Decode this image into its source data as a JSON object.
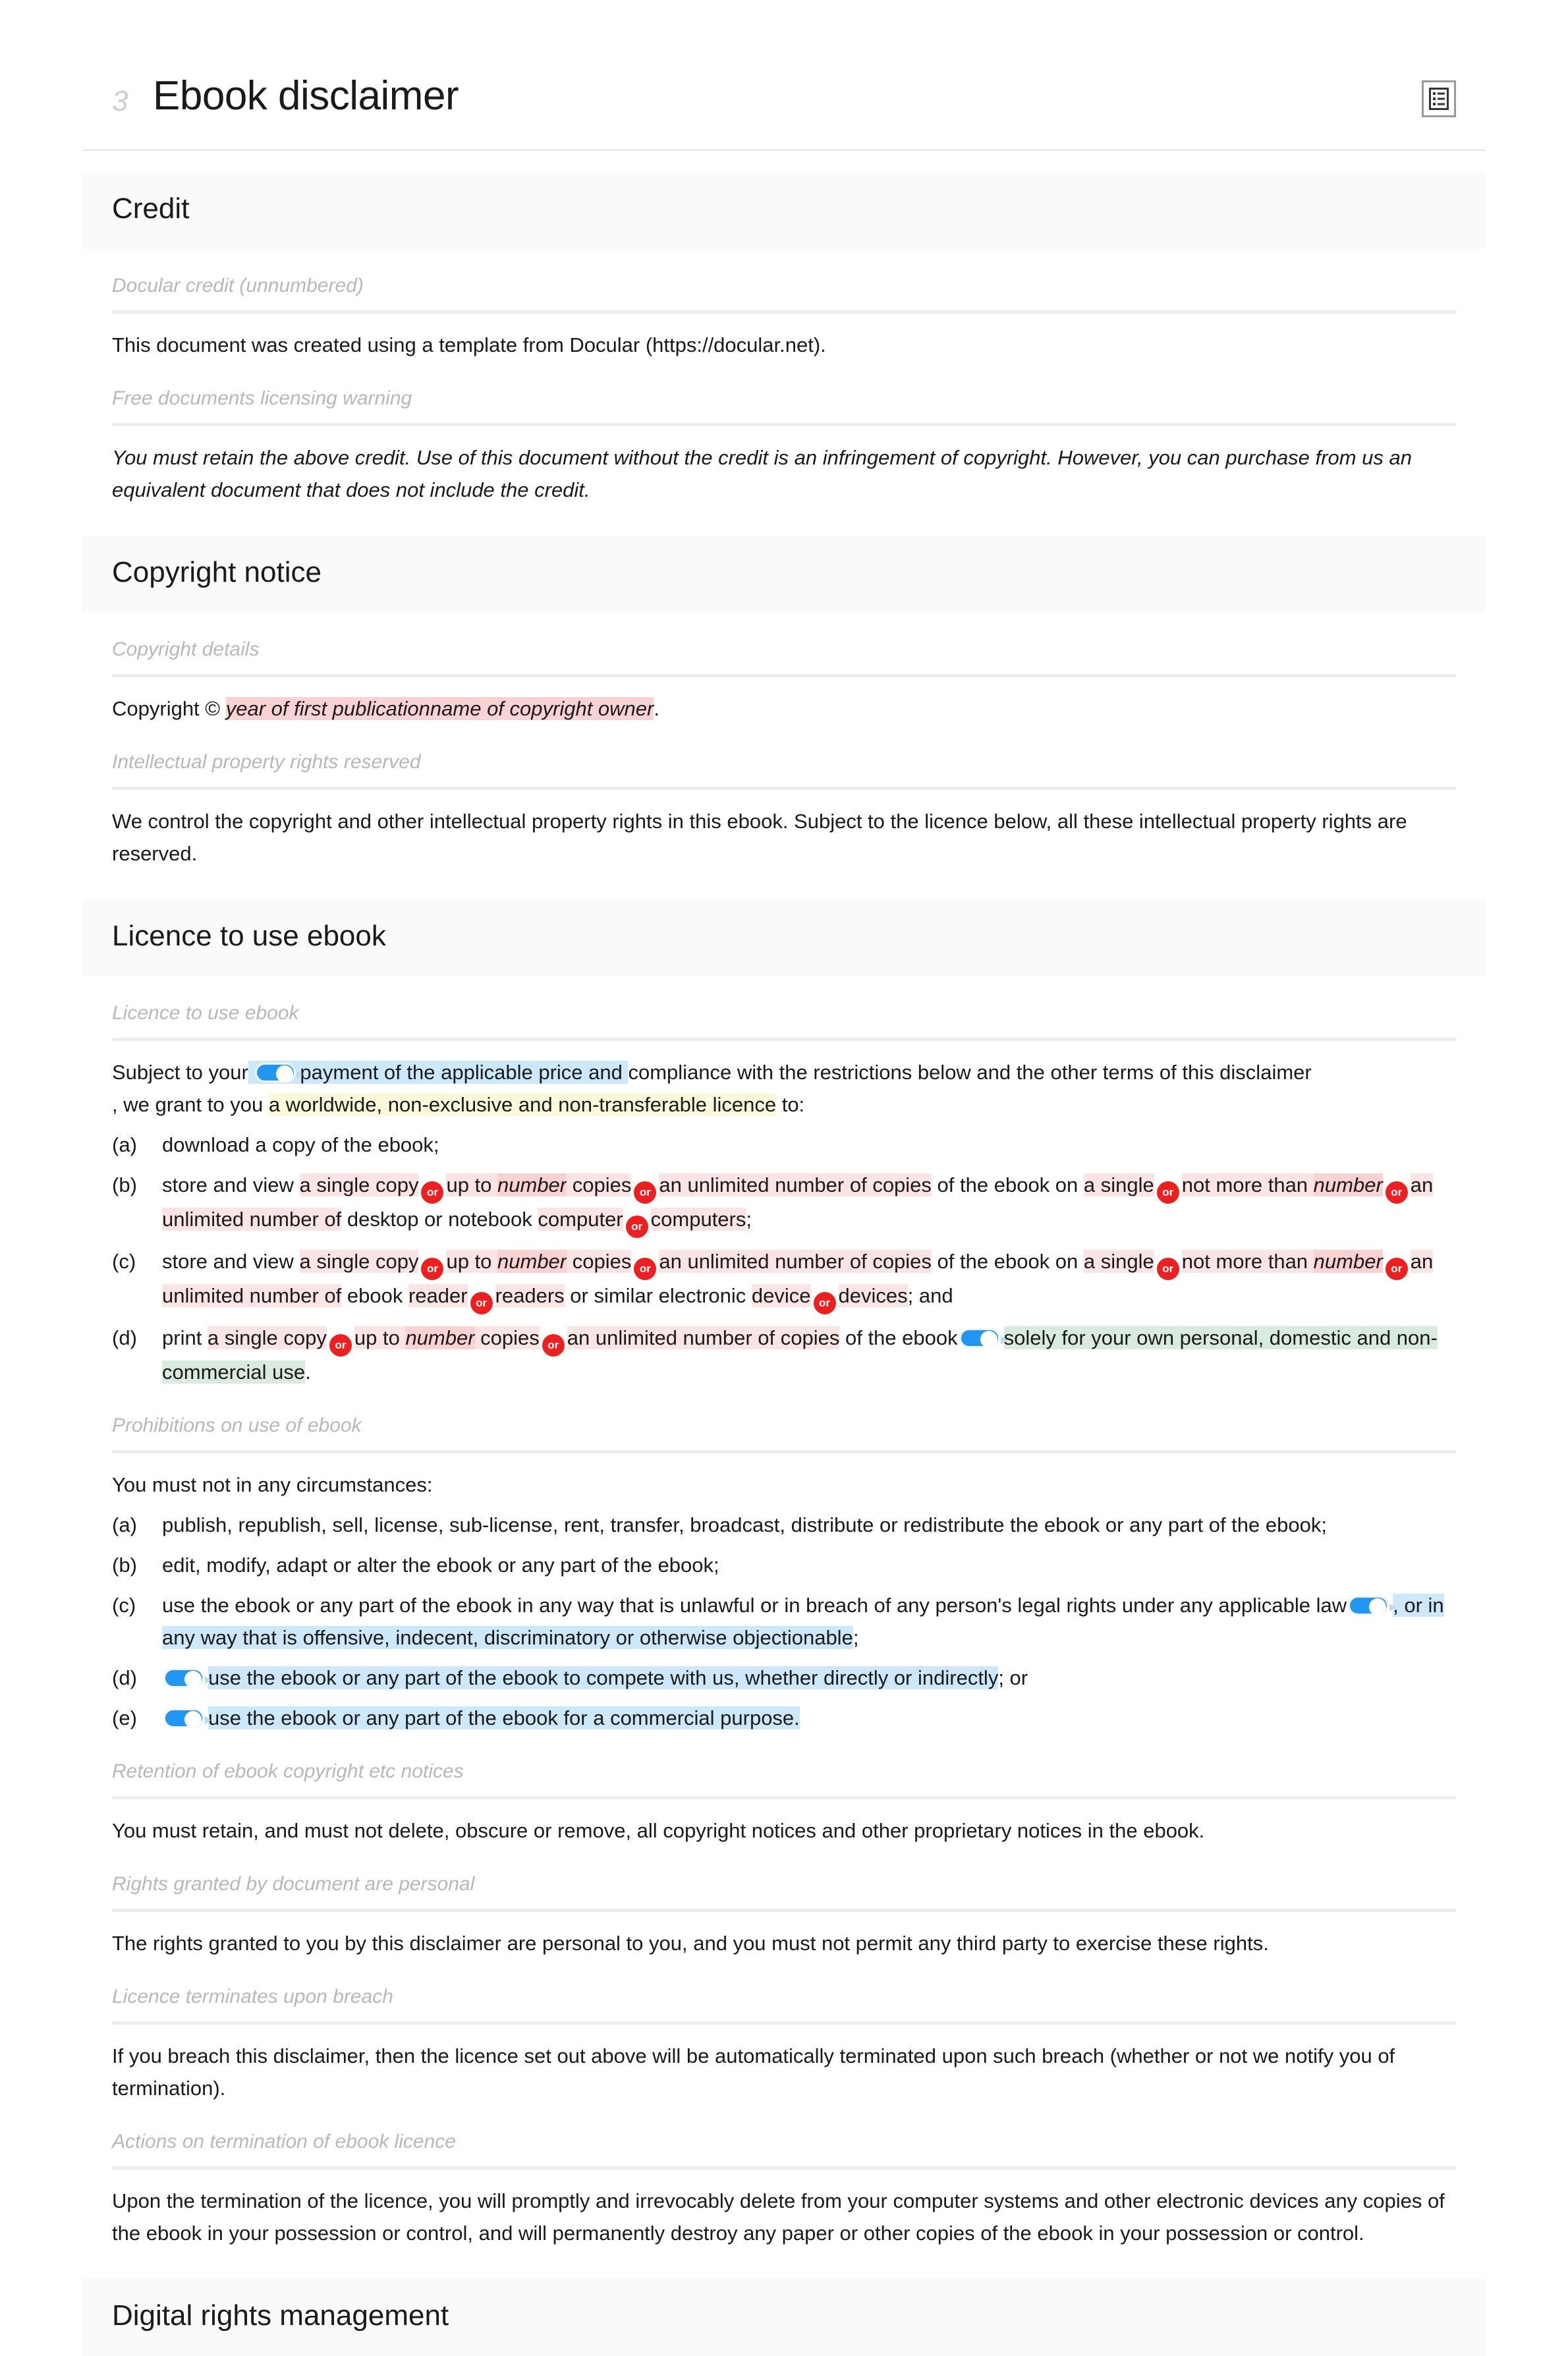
{
  "header": {
    "page_number": "3",
    "title": "Ebook disclaimer",
    "toc_icon": "list-document-icon"
  },
  "colors": {
    "accent_blue": "#2196f3",
    "badge_red": "#ef1f1f",
    "highlight_pink": "#fbe4e4",
    "highlight_pink_deep": "#fad2d2",
    "highlight_blue": "#cde8fb",
    "highlight_yellow": "#fbf8dc",
    "highlight_green": "#d9ebdf",
    "band_gray": "#fafafa",
    "label_gray": "#b8b8b8"
  },
  "sections": [
    {
      "title": "Credit",
      "clauses": [
        {
          "label": "Docular credit (unnumbered)",
          "text": "This document was created using a template from Docular (https://docular.net)."
        },
        {
          "label": "Free documents licensing warning",
          "text": "You must retain the above credit. Use of this document without the credit is an infringement of copyright. However, you can purchase from us an equivalent document that does not include the credit."
        }
      ]
    },
    {
      "title": "Copyright notice",
      "clauses": [
        {
          "label": "Copyright details",
          "text_prefix": "Copyright © ",
          "var_year": "year of first publication",
          "var_owner": "name of copyright owner",
          "text_suffix": "."
        },
        {
          "label": "Intellectual property rights reserved",
          "text": "We control the copyright and other intellectual property rights in this ebook. Subject to the licence below, all these intellectual property rights are reserved."
        }
      ]
    },
    {
      "title": "Licence to use ebook",
      "clauses": [
        {
          "label": "Licence to use ebook",
          "intro": {
            "p1": "Subject to your",
            "opt_payment": "payment of the applicable price and",
            "p2": "compliance with the restrictions below and the other terms of this disclaimer",
            "p3": ", we grant to you",
            "opt_licence": "a worldwide, non-exclusive and non-transferable licence",
            "p4": "to:"
          },
          "items": [
            {
              "marker": "(a)",
              "parts": [
                {
                  "t": "plain",
                  "v": "download a copy of the ebook;"
                }
              ]
            },
            {
              "marker": "(b)",
              "parts": [
                {
                  "t": "plain",
                  "v": "store and view "
                },
                {
                  "t": "pink",
                  "v": "a single copy"
                },
                {
                  "t": "or",
                  "v": "or"
                },
                {
                  "t": "pink",
                  "v": "up to "
                },
                {
                  "t": "pinkd",
                  "v": "number"
                },
                {
                  "t": "pink",
                  "v": " copies"
                },
                {
                  "t": "or",
                  "v": "or"
                },
                {
                  "t": "pink",
                  "v": "an unlimited number of copies"
                },
                {
                  "t": "plain",
                  "v": " of the ebook on "
                },
                {
                  "t": "pink",
                  "v": "a single"
                },
                {
                  "t": "or",
                  "v": "or"
                },
                {
                  "t": "pink",
                  "v": "not more than "
                },
                {
                  "t": "pinkd",
                  "v": "number"
                },
                {
                  "t": "or",
                  "v": "or"
                },
                {
                  "t": "pink",
                  "v": "an unlimited number of"
                },
                {
                  "t": "plain",
                  "v": " desktop or notebook "
                },
                {
                  "t": "pink",
                  "v": "computer"
                },
                {
                  "t": "or",
                  "v": "or"
                },
                {
                  "t": "pink",
                  "v": "computers"
                },
                {
                  "t": "plain",
                  "v": ";"
                }
              ]
            },
            {
              "marker": "(c)",
              "parts": [
                {
                  "t": "plain",
                  "v": "store and view "
                },
                {
                  "t": "pink",
                  "v": "a single copy"
                },
                {
                  "t": "or",
                  "v": "or"
                },
                {
                  "t": "pink",
                  "v": "up to "
                },
                {
                  "t": "pinkd",
                  "v": "number"
                },
                {
                  "t": "pink",
                  "v": " copies"
                },
                {
                  "t": "or",
                  "v": "or"
                },
                {
                  "t": "pink",
                  "v": "an unlimited number of copies"
                },
                {
                  "t": "plain",
                  "v": " of the ebook on "
                },
                {
                  "t": "pink",
                  "v": "a single"
                },
                {
                  "t": "or",
                  "v": "or"
                },
                {
                  "t": "pink",
                  "v": "not more than "
                },
                {
                  "t": "pinkd",
                  "v": "number"
                },
                {
                  "t": "or",
                  "v": "or"
                },
                {
                  "t": "pink",
                  "v": "an unlimited number of"
                },
                {
                  "t": "plain",
                  "v": " ebook "
                },
                {
                  "t": "pink",
                  "v": "reader"
                },
                {
                  "t": "or",
                  "v": "or"
                },
                {
                  "t": "pink",
                  "v": "readers"
                },
                {
                  "t": "plain",
                  "v": " or similar electronic "
                },
                {
                  "t": "pink",
                  "v": "device"
                },
                {
                  "t": "or",
                  "v": "or"
                },
                {
                  "t": "pink",
                  "v": "devices"
                },
                {
                  "t": "plain",
                  "v": "; and"
                }
              ]
            },
            {
              "marker": "(d)",
              "parts": [
                {
                  "t": "plain",
                  "v": "print "
                },
                {
                  "t": "pink",
                  "v": "a single copy"
                },
                {
                  "t": "or",
                  "v": "or"
                },
                {
                  "t": "pink",
                  "v": "up to "
                },
                {
                  "t": "pinkd",
                  "v": "number"
                },
                {
                  "t": "pink",
                  "v": " copies"
                },
                {
                  "t": "or",
                  "v": "or"
                },
                {
                  "t": "pink",
                  "v": "an unlimited number of copies"
                },
                {
                  "t": "plain",
                  "v": " of the ebook"
                },
                {
                  "t": "toggle",
                  "v": "toggle-switch-on"
                },
                {
                  "t": "green",
                  "v": "solely for your own personal, domestic and non-commercial use"
                },
                {
                  "t": "plain",
                  "v": "."
                }
              ]
            }
          ]
        },
        {
          "label": "Prohibitions on use of ebook",
          "intro_plain": "You must not in any circumstances:",
          "items": [
            {
              "marker": "(a)",
              "parts": [
                {
                  "t": "plain",
                  "v": "publish, republish, sell, license, sub-license, rent, transfer, broadcast, distribute or redistribute the ebook or any part of the ebook;"
                }
              ]
            },
            {
              "marker": "(b)",
              "parts": [
                {
                  "t": "plain",
                  "v": "edit, modify, adapt or alter the ebook or any part of the ebook;"
                }
              ]
            },
            {
              "marker": "(c)",
              "parts": [
                {
                  "t": "plain",
                  "v": "use the ebook or any part of the ebook in any way that is unlawful or in breach of any person's legal rights under any applicable law"
                },
                {
                  "t": "toggle",
                  "v": "toggle-switch-on"
                },
                {
                  "t": "blue",
                  "v": ", or in any way that is offensive, indecent, discriminatory or otherwise objectionable"
                },
                {
                  "t": "plain",
                  "v": ";"
                }
              ]
            },
            {
              "marker": "(d)",
              "parts": [
                {
                  "t": "toggle",
                  "v": "toggle-switch-on"
                },
                {
                  "t": "blue",
                  "v": "use the ebook or any part of the ebook to compete with us, whether directly or indirectly"
                },
                {
                  "t": "plain",
                  "v": "; or"
                }
              ]
            },
            {
              "marker": "(e)",
              "parts": [
                {
                  "t": "toggle",
                  "v": "toggle-switch-on"
                },
                {
                  "t": "blue",
                  "v": "use the ebook or any part of the ebook for a commercial purpose."
                }
              ]
            }
          ]
        },
        {
          "label": "Retention of ebook copyright etc notices",
          "text": "You must retain, and must not delete, obscure or remove, all copyright notices and other proprietary notices in the ebook."
        },
        {
          "label": "Rights granted by document are personal",
          "text": "The rights granted to you by this disclaimer are personal to you, and you must not permit any third party to exercise these rights."
        },
        {
          "label": "Licence terminates upon breach",
          "text": "If you breach this disclaimer, then the licence set out above will be automatically terminated upon such breach (whether or not we notify you of termination)."
        },
        {
          "label": "Actions on termination of ebook licence",
          "text": "Upon the termination of the licence, you will promptly and irrevocably delete from your computer systems and other electronic devices any copies of the ebook in your possession or control, and will permanently destroy any paper or other copies of the ebook in your possession or control."
        }
      ]
    },
    {
      "title": "Digital rights management",
      "clauses": []
    }
  ]
}
